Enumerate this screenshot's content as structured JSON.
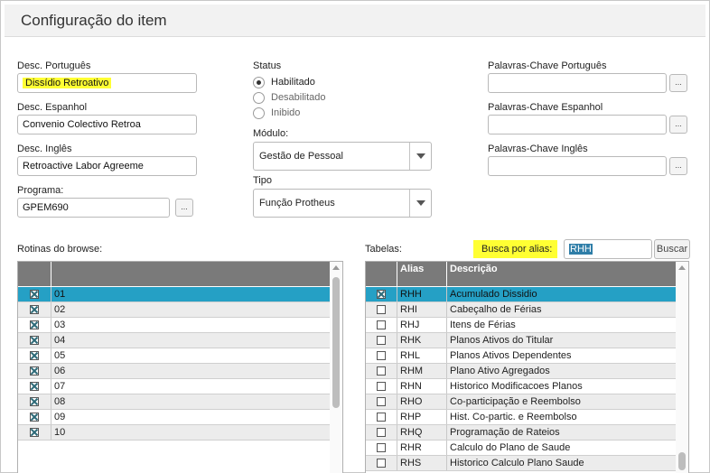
{
  "window": {
    "title": "Configuração do item"
  },
  "left_form": {
    "desc_pt_label": "Desc. Português",
    "desc_pt_value": "Dissídio Retroativo",
    "desc_es_label": "Desc. Espanhol",
    "desc_es_value": "Convenio Colectivo Retroa",
    "desc_en_label": "Desc. Inglês",
    "desc_en_value": "Retroactive Labor Agreeme",
    "program_label": "Programa:",
    "program_value": "GPEM690",
    "lookup_label": "..."
  },
  "middle_form": {
    "status_label": "Status",
    "status_options": [
      "Habilitado",
      "Desabilitado",
      "Inibido"
    ],
    "status_selected": "Habilitado",
    "module_label": "Módulo:",
    "module_value": "Gestão de Pessoal",
    "type_label": "Tipo",
    "type_value": "Função Protheus"
  },
  "right_form": {
    "kw_pt_label": "Palavras-Chave Português",
    "kw_pt_value": "",
    "kw_es_label": "Palavras-Chave Espanhol",
    "kw_es_value": "",
    "kw_en_label": "Palavras-Chave Inglês",
    "kw_en_value": "",
    "lookup_label": "..."
  },
  "browse": {
    "label": "Rotinas do browse:",
    "rows": [
      "01",
      "02",
      "03",
      "04",
      "05",
      "06",
      "07",
      "08",
      "09",
      "10"
    ],
    "selected_index": 0
  },
  "tables": {
    "label": "Tabelas:",
    "search_label": "Busca por alias:",
    "search_value": "RHH",
    "search_button": "Buscar",
    "columns": [
      "Alias",
      "Descrição"
    ],
    "rows": [
      {
        "alias": "RHH",
        "desc": "Acumulado Dissidio",
        "checked": true
      },
      {
        "alias": "RHI",
        "desc": "Cabeçalho de Férias",
        "checked": false
      },
      {
        "alias": "RHJ",
        "desc": "Itens de Férias",
        "checked": false
      },
      {
        "alias": "RHK",
        "desc": "Planos Ativos do Titular",
        "checked": false
      },
      {
        "alias": "RHL",
        "desc": "Planos Ativos Dependentes",
        "checked": false
      },
      {
        "alias": "RHM",
        "desc": "Plano Ativo Agregados",
        "checked": false
      },
      {
        "alias": "RHN",
        "desc": "Historico Modificacoes Planos",
        "checked": false
      },
      {
        "alias": "RHO",
        "desc": "Co-participação e Reembolso",
        "checked": false
      },
      {
        "alias": "RHP",
        "desc": "Hist. Co-partic. e Reembolso",
        "checked": false
      },
      {
        "alias": "RHQ",
        "desc": "Programação de Rateios",
        "checked": false
      },
      {
        "alias": "RHR",
        "desc": "Calculo do Plano de Saude",
        "checked": false
      },
      {
        "alias": "RHS",
        "desc": "Historico Calculo Plano Saude",
        "checked": false
      }
    ],
    "selected_index": 0
  }
}
